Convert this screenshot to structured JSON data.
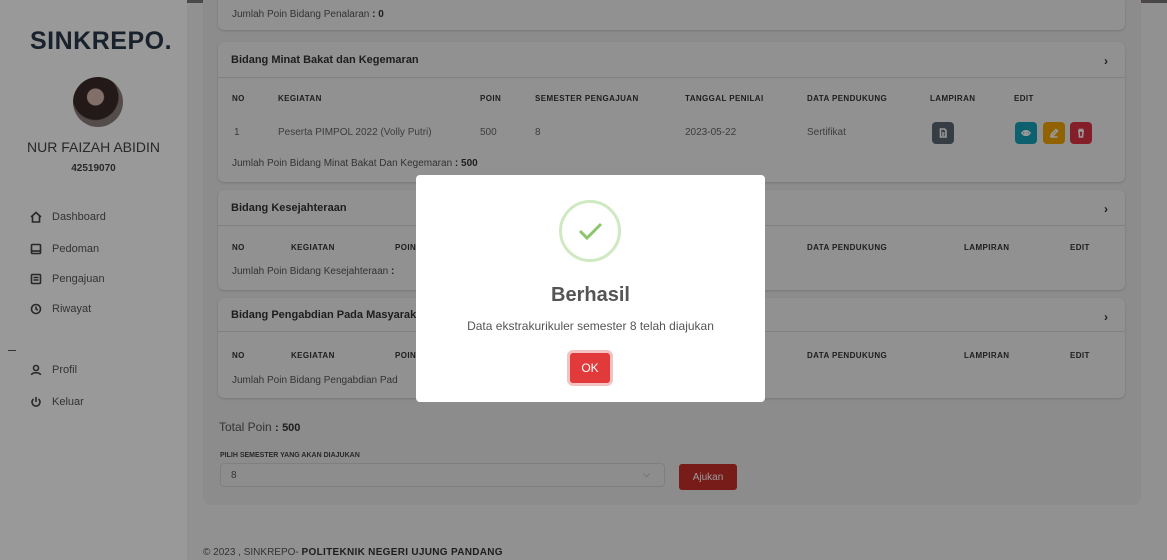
{
  "sidebar": {
    "brand": "SINKREPO.",
    "user_name": "NUR FAIZAH ABIDIN",
    "user_id": "42519070",
    "nav": [
      {
        "label": "Dashboard",
        "icon": "home-icon"
      },
      {
        "label": "Pedoman",
        "icon": "book-icon"
      },
      {
        "label": "Pengajuan",
        "icon": "form-icon"
      },
      {
        "label": "Riwayat",
        "icon": "history-icon"
      },
      {
        "label": "Profil",
        "icon": "user-icon"
      },
      {
        "label": "Keluar",
        "icon": "power-icon"
      }
    ]
  },
  "top_partial": {
    "label": "Jumlah Poin Bidang Penalaran",
    "colon": ":",
    "value": "0"
  },
  "minat": {
    "title": "Bidang Minat Bakat dan Kegemaran",
    "headers": [
      "NO",
      "KEGIATAN",
      "POIN",
      "SEMESTER PENGAJUAN",
      "TANGGAL PENILAI",
      "DATA PENDUKUNG",
      "LAMPIRAN",
      "EDIT"
    ],
    "row": {
      "no": "1",
      "kegiatan": "Peserta PIMPOL 2022 (Volly Putri)",
      "poin": "500",
      "semester": "8",
      "tanggal": "2023-05-22",
      "pendukung": "Sertifikat"
    },
    "sum_label": "Jumlah Poin Bidang Minat Bakat Dan Kegemaran",
    "sum_colon": ":",
    "sum_value": "500"
  },
  "kesejahteraan": {
    "title": "Bidang Kesejahteraan",
    "headers": [
      "NO",
      "KEGIATAN",
      "POIN",
      "DATA PENDUKUNG",
      "LAMPIRAN",
      "EDIT"
    ],
    "sum_label": "Jumlah Poin Bidang Kesejahteraan",
    "sum_colon": ":"
  },
  "pengabdian": {
    "title": "Bidang Pengabdian Pada Masyarak",
    "headers": [
      "NO",
      "KEGIATAN",
      "POIN",
      "DATA PENDUKUNG",
      "LAMPIRAN",
      "EDIT"
    ],
    "sum_label": "Jumlah Poin Bidang Pengabdian Pad"
  },
  "total": {
    "label": "Total Poin",
    "colon": ":",
    "value": "500"
  },
  "semester_select": {
    "label": "PILIH SEMESTER YANG AKAN DIAJUKAN",
    "value": "8"
  },
  "submit_label": "Ajukan",
  "footer": {
    "text": "© 2023 , SINKREPO-",
    "bold": "POLITEKNIK NEGERI UJUNG PANDANG"
  },
  "modal": {
    "title": "Berhasil",
    "message": "Data ekstrakurikuler semester 8 telah diajukan",
    "ok_label": "OK"
  },
  "colors": {
    "accent_red": "#c9302c",
    "ok_red": "#e23a3a",
    "view": "#17a2b8",
    "edit": "#f0a500",
    "delete": "#dc3545",
    "lampiran": "#5a6773",
    "success": "#8ac66e"
  }
}
